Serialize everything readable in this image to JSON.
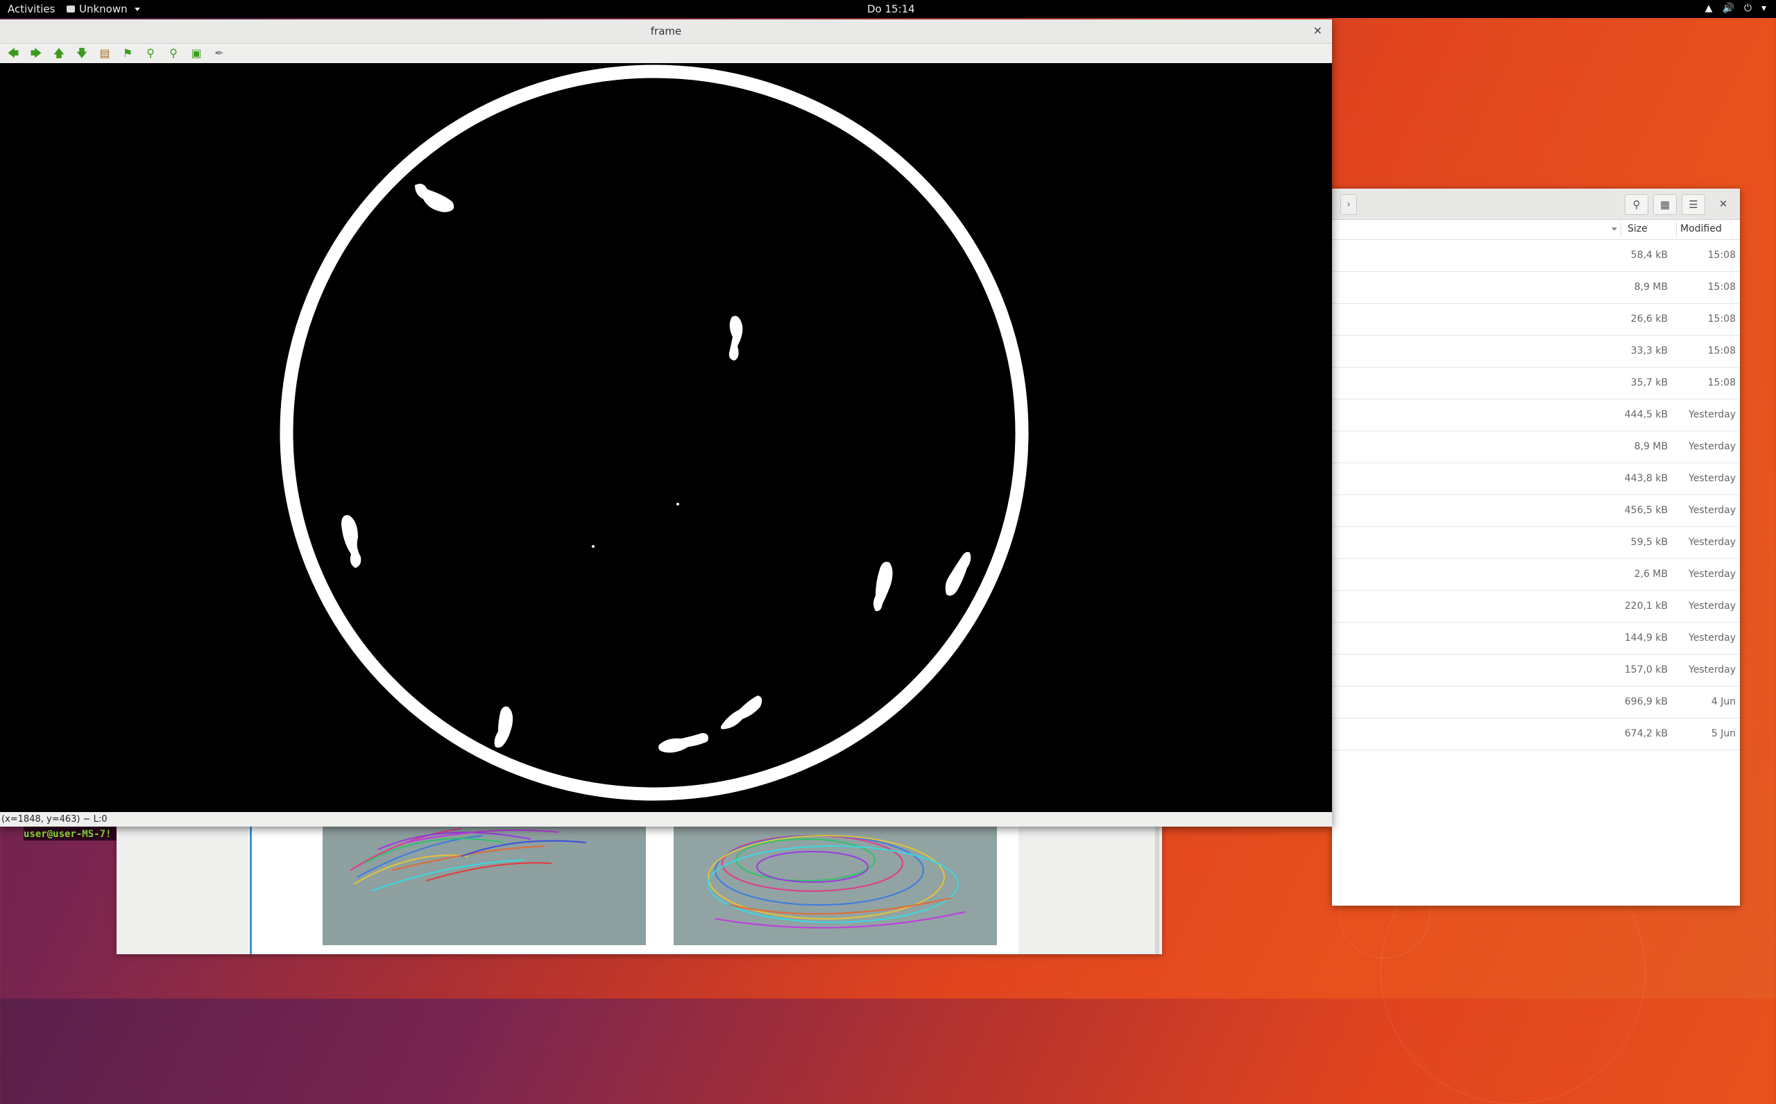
{
  "topbar": {
    "activities": "Activities",
    "app_menu": "Unknown",
    "clock": "Do 15:14",
    "icons": [
      "network-icon",
      "volume-icon",
      "power-icon",
      "chevron-down-icon"
    ]
  },
  "frame_window": {
    "title": "frame",
    "close_label": "×",
    "toolbar_icons": [
      "arrow-left-icon",
      "arrow-right-icon",
      "arrow-up-icon",
      "arrow-down-icon",
      "image-icon",
      "flag-icon",
      "zoom-in-icon",
      "zoom-out-icon",
      "save-icon",
      "brush-icon"
    ],
    "status": "(x=1848, y=463) ~ L:0"
  },
  "files_window": {
    "columns": {
      "size": "Size",
      "modified": "Modified"
    },
    "rows": [
      {
        "size": "58,4 kB",
        "modified": "15:08"
      },
      {
        "size": "8,9 MB",
        "modified": "15:08"
      },
      {
        "size": "26,6 kB",
        "modified": "15:08"
      },
      {
        "size": "33,3 kB",
        "modified": "15:08"
      },
      {
        "size": "35,7 kB",
        "modified": "15:08"
      },
      {
        "size": "444,5 kB",
        "modified": "Yesterday"
      },
      {
        "size": "8,9 MB",
        "modified": "Yesterday"
      },
      {
        "size": "443,8 kB",
        "modified": "Yesterday"
      },
      {
        "size": "456,5 kB",
        "modified": "Yesterday"
      },
      {
        "size": "59,5 kB",
        "modified": "Yesterday"
      },
      {
        "size": "2,6 MB",
        "modified": "Yesterday"
      },
      {
        "size": "220,1 kB",
        "modified": "Yesterday"
      },
      {
        "size": "144,9 kB",
        "modified": "Yesterday"
      },
      {
        "size": "157,0 kB",
        "modified": "Yesterday"
      },
      {
        "size": "696,9 kB",
        "modified": "4 Jun"
      },
      {
        "size": "674,2 kB",
        "modified": "5 Jun"
      }
    ]
  },
  "terminal": {
    "prompt": "user@user-MS-7!"
  }
}
